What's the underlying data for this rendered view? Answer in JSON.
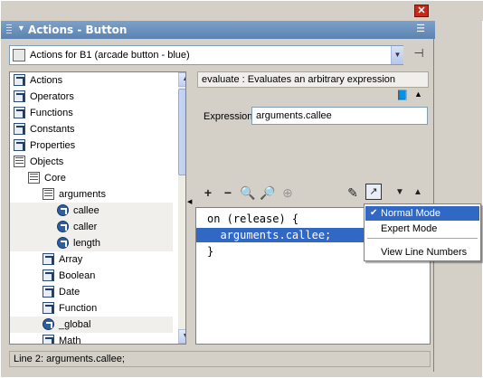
{
  "window": {
    "title": "Actions - Button",
    "close_glyph": "✕",
    "options_glyph": "☰"
  },
  "target_bar": {
    "selected": "Actions for B1 (arcade button - blue)"
  },
  "tree": {
    "items": [
      {
        "label": "Actions",
        "icon": "book-icon",
        "depth": 0
      },
      {
        "label": "Operators",
        "icon": "book-icon",
        "depth": 0
      },
      {
        "label": "Functions",
        "icon": "book-icon",
        "depth": 0
      },
      {
        "label": "Constants",
        "icon": "book-icon",
        "depth": 0
      },
      {
        "label": "Properties",
        "icon": "book-icon",
        "depth": 0
      },
      {
        "label": "Objects",
        "icon": "open-book-icon",
        "depth": 0
      },
      {
        "label": "Core",
        "icon": "open-book-icon",
        "depth": 1
      },
      {
        "label": "arguments",
        "icon": "open-book-icon",
        "depth": 2
      },
      {
        "label": "callee",
        "icon": "action-circle-icon",
        "depth": 3
      },
      {
        "label": "caller",
        "icon": "action-circle-icon",
        "depth": 3
      },
      {
        "label": "length",
        "icon": "action-circle-icon",
        "depth": 3
      },
      {
        "label": "Array",
        "icon": "book-icon",
        "depth": 2
      },
      {
        "label": "Boolean",
        "icon": "book-icon",
        "depth": 2
      },
      {
        "label": "Date",
        "icon": "book-icon",
        "depth": 2
      },
      {
        "label": "Function",
        "icon": "book-icon",
        "depth": 2
      },
      {
        "label": "_global",
        "icon": "action-circle-icon",
        "depth": 2
      },
      {
        "label": "Math",
        "icon": "book-icon",
        "depth": 2
      }
    ]
  },
  "description": "evaluate : Evaluates an arbitrary expression",
  "expression": {
    "label": "Expression:",
    "value": "arguments.callee"
  },
  "toolbar": {
    "add": "+",
    "remove": "−"
  },
  "code": {
    "lines": [
      "on (release) {",
      "  arguments.callee;",
      "}"
    ],
    "selected_line": 1
  },
  "view_menu": {
    "items": [
      "Normal Mode",
      "Expert Mode",
      "View Line Numbers"
    ],
    "checked": "Normal Mode"
  },
  "status": "Line 2: arguments.callee;",
  "colors": {
    "title_bar": "#6a8fbd",
    "selection": "#3168c5"
  }
}
